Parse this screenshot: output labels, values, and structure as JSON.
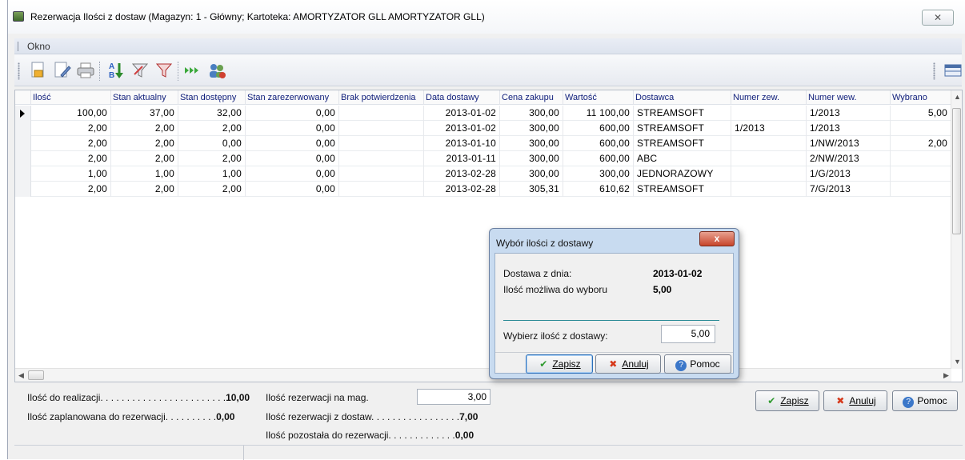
{
  "window": {
    "title": "Rezerwacja Ilości z dostaw (Magazyn: 1 - Główny; Kartoteka: AMORTYZATOR GLL AMORTYZATOR GLL)",
    "close_glyph": "✕"
  },
  "menu": {
    "okno": "Okno"
  },
  "toolbar": {
    "icons": [
      "new-document-icon",
      "edit-document-icon",
      "print-icon",
      "sort-az-icon",
      "filter-icon",
      "filter-red-icon",
      "next-records-icon",
      "users-settings-icon"
    ]
  },
  "grid": {
    "columns": [
      "Ilość",
      "Stan aktualny",
      "Stan dostępny",
      "Stan zarezerwowany",
      "Brak potwierdzenia",
      "Data dostawy",
      "Cena zakupu",
      "Wartość",
      "Dostawca",
      "Numer zew.",
      "Numer wew.",
      "Wybrano"
    ],
    "rows": [
      {
        "ilosc": "100,00",
        "aktualny": "37,00",
        "dostepny": "32,00",
        "zarezerwowany": "0,00",
        "brak": "",
        "data": "2013-01-02",
        "cena": "300,00",
        "wartosc": "11 100,00",
        "dostawca": "STREAMSOFT",
        "zew": "",
        "wew": "1/2013",
        "wybrano": "5,00"
      },
      {
        "ilosc": "2,00",
        "aktualny": "2,00",
        "dostepny": "2,00",
        "zarezerwowany": "0,00",
        "brak": "",
        "data": "2013-01-02",
        "cena": "300,00",
        "wartosc": "600,00",
        "dostawca": "STREAMSOFT",
        "zew": "1/2013",
        "wew": "1/2013",
        "wybrano": ""
      },
      {
        "ilosc": "2,00",
        "aktualny": "2,00",
        "dostepny": "0,00",
        "zarezerwowany": "0,00",
        "brak": "",
        "data": "2013-01-10",
        "cena": "300,00",
        "wartosc": "600,00",
        "dostawca": "STREAMSOFT",
        "zew": "",
        "wew": "1/NW/2013",
        "wybrano": "2,00"
      },
      {
        "ilosc": "2,00",
        "aktualny": "2,00",
        "dostepny": "2,00",
        "zarezerwowany": "0,00",
        "brak": "",
        "data": "2013-01-11",
        "cena": "300,00",
        "wartosc": "600,00",
        "dostawca": "ABC",
        "zew": "",
        "wew": "2/NW/2013",
        "wybrano": ""
      },
      {
        "ilosc": "1,00",
        "aktualny": "1,00",
        "dostepny": "1,00",
        "zarezerwowany": "0,00",
        "brak": "",
        "data": "2013-02-28",
        "cena": "300,00",
        "wartosc": "300,00",
        "dostawca": "JEDNORAZOWY",
        "zew": "",
        "wew": "1/G/2013",
        "wybrano": ""
      },
      {
        "ilosc": "2,00",
        "aktualny": "2,00",
        "dostepny": "2,00",
        "zarezerwowany": "0,00",
        "brak": "",
        "data": "2013-02-28",
        "cena": "305,31",
        "wartosc": "610,62",
        "dostawca": "STREAMSOFT",
        "zew": "",
        "wew": "7/G/2013",
        "wybrano": ""
      }
    ]
  },
  "summary": {
    "do_realizacji_label": "Ilość do realizacji. . . . . . . . . . . . . . . . . . . . . . . .",
    "do_realizacji_value": "10,00",
    "zaplanowana_label": "Ilość zaplanowana do rezerwacji. . . . . . . . . .",
    "zaplanowana_value": "0,00",
    "na_mag_label": "Ilość rezerwacji na mag.",
    "na_mag_value": "3,00",
    "z_dostaw_label": "Ilość rezerwacji z dostaw. . . . . . . . . . . . . . . . .",
    "z_dostaw_value": "7,00",
    "pozostala_label": "Ilość pozostała do rezerwacji. . . . . . . . . . . . .",
    "pozostala_value": "0,00"
  },
  "buttons": {
    "zapisz": "Zapisz",
    "anuluj": "Anuluj",
    "pomoc": "Pomoc"
  },
  "dialog": {
    "title": "Wybór ilości z dostawy",
    "dostawa_label": "Dostawa z dnia:",
    "dostawa_value": "2013-01-02",
    "mozliwa_label": "Ilość możliwa do wyboru",
    "mozliwa_value": "5,00",
    "wybierz_label": "Wybierz ilość z dostawy:",
    "wybierz_value": "5,00",
    "close_glyph": "x",
    "zapisz": "Zapisz",
    "anuluj": "Anuluj",
    "pomoc": "Pomoc"
  }
}
